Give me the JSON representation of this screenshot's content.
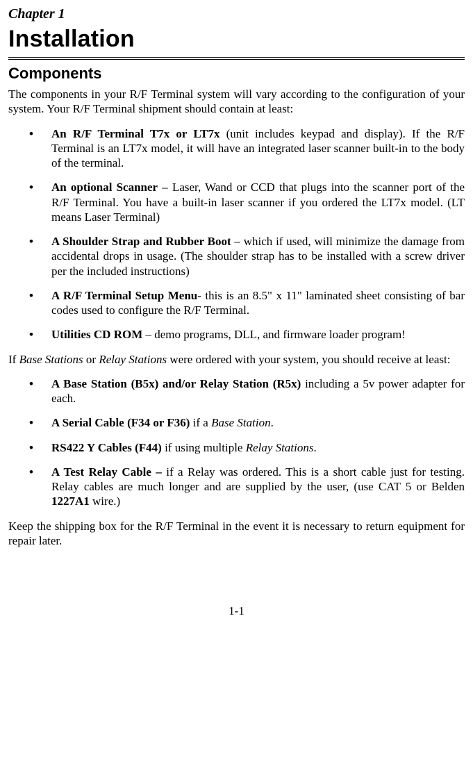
{
  "chapter": "Chapter 1",
  "title": "Installation",
  "section1": "Components",
  "intro": "The components in your R/F Terminal system will vary according to the configuration of your system.  Your R/F Terminal shipment should contain at least:",
  "list1": [
    {
      "b": "An R/F Terminal T7x or LT7x",
      "rest": " (unit includes keypad and display).  If the R/F Terminal is an LT7x model, it will have an integrated laser scanner built-in to the body of the terminal."
    },
    {
      "b": "An optional Scanner",
      "rest": " – Laser, Wand or CCD that plugs into the scanner port of the R/F Terminal.  You have a built-in laser scanner if you ordered the LT7x model. (LT means Laser Terminal)"
    },
    {
      "b": "A Shoulder Strap and Rubber Boot",
      "rest": " – which if used, will minimize the damage from accidental drops in usage. (The shoulder strap has to be installed with a screw driver per the included instructions)"
    },
    {
      "b": "A R/F Terminal Setup Menu",
      "rest": "- this is an 8.5\" x 11\" laminated sheet consisting of bar codes used to configure the R/F Terminal."
    },
    {
      "b": "Utilities CD ROM",
      "rest": " – demo programs, DLL, and firmware loader program!"
    }
  ],
  "para2_pre": "If ",
  "para2_i1": "Base Stations",
  "para2_mid": " or ",
  "para2_i2": "Relay Stations",
  "para2_post": " were ordered with your system, you should receive at least:",
  "list2": [
    {
      "b": "A Base Station (B5x) and/or Relay Station (R5x)",
      "rest": " including a 5v power adapter for each."
    },
    {
      "b": "A Serial Cable (F34 or F36)",
      "rest_pre": " if a ",
      "rest_i": "Base Station",
      "rest_post": "."
    },
    {
      "b": "RS422 Y Cables (F44)",
      "rest_pre": " if using multiple ",
      "rest_i": "Relay Stations",
      "rest_post": "."
    },
    {
      "b": "A Test Relay Cable –",
      "rest_pre": " if a Relay was ordered. This is a short cable just for testing. Relay cables are much longer and are supplied by the user, (use CAT 5 or Belden ",
      "rest_b2": "1227A1",
      "rest_post2": " wire.)"
    }
  ],
  "closing": "Keep the shipping box for the R/F Terminal in the event it is necessary to return equipment for repair later.",
  "pagenum": "1-1"
}
